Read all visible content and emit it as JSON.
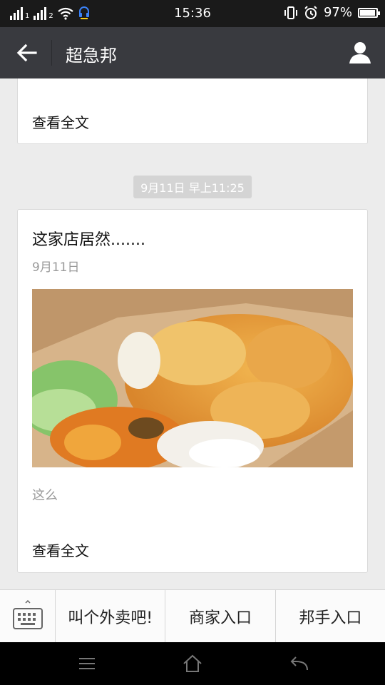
{
  "status_bar": {
    "time": "15:36",
    "sim1_label": "1",
    "sim2_label": "2",
    "battery_percent": "97%",
    "battery_level": 0.97,
    "icons": [
      "signal-icon",
      "wifi-icon",
      "headset-icon",
      "vibrate-icon",
      "alarm-icon",
      "battery-icon"
    ]
  },
  "header": {
    "title": "超急邦",
    "back_icon": "arrow-left-icon",
    "profile_icon": "person-icon"
  },
  "feed": {
    "previous_card": {
      "read_more": "查看全文"
    },
    "timestamp": "9月11日 早上11:25",
    "article": {
      "title": "这家店居然.......",
      "date": "9月11日",
      "snippet": "这么",
      "read_more": "查看全文"
    }
  },
  "bottom_menu": {
    "keyboard_icon": "keyboard-icon",
    "items": [
      {
        "label": "叫个外卖吧!"
      },
      {
        "label": "商家入口"
      },
      {
        "label": "邦手入口"
      }
    ]
  },
  "nav_bar": {
    "icons": [
      "menu-icon",
      "home-icon",
      "back-icon"
    ]
  },
  "colors": {
    "title_bar": "#393a3f",
    "background": "#ececec",
    "muted_text": "#9a9a9a"
  }
}
